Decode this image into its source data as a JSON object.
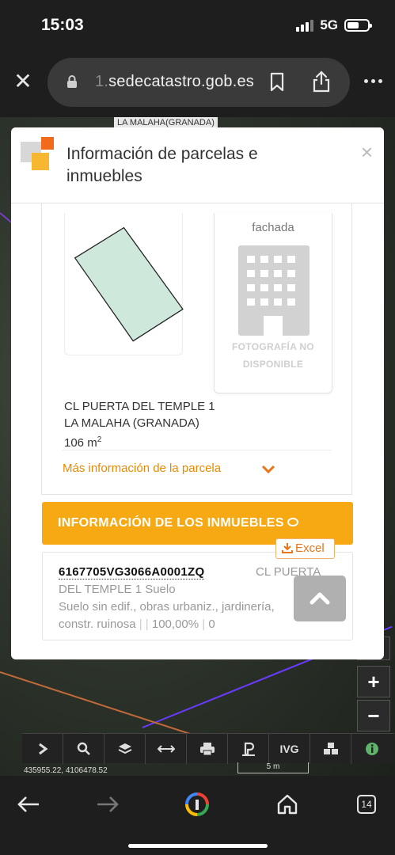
{
  "status_bar": {
    "time": "15:03",
    "network": "5G"
  },
  "browser": {
    "url_prefix": "1.",
    "url_main": "sedecatastro.gob.es",
    "tabs_count": "14"
  },
  "map": {
    "place_label": "LA MALAHA(GRANADA)",
    "zoom_in": "+",
    "zoom_out": "−",
    "coordinates": "435955.22, 4106478.52",
    "scale": "5 m",
    "toolbar": [
      "chevron-right-icon",
      "search-icon",
      "layers-icon",
      "measure-icon",
      "print-icon",
      "P",
      "IVG",
      "cubes-icon",
      "info-icon"
    ],
    "toolbar_ivg": "IVG"
  },
  "modal": {
    "title": "Información de parcelas e inmuebles",
    "close": "×",
    "photo_label_top": "fachada",
    "photo_na_line1": "FOTOGRAFÍA NO",
    "photo_na_line2": "DISPONIBLE",
    "address_line1": "CL PUERTA DEL TEMPLE 1",
    "address_line2": "LA MALAHA (GRANADA)",
    "area_value": "106 m",
    "area_sup": "2",
    "more_info": "Más información de la parcela",
    "inmuebles_header": "INFORMACIÓN DE LOS INMUEBLES",
    "excel_label": "Excel",
    "result": {
      "ref": "6167705VG3066A0001ZQ",
      "addr_part1": "CL PUERTA",
      "addr_part2": "DEL TEMPLE 1 Suelo",
      "desc": "Suelo sin edif., obras urbaniz., jardinería,",
      "desc2": "constr. ruinosa",
      "percent": "100,00%",
      "count": "0"
    }
  },
  "colors": {
    "accent_orange": "#f6a913",
    "parcel_fill": "#cfe8dc",
    "link_orange": "#e88a00"
  }
}
